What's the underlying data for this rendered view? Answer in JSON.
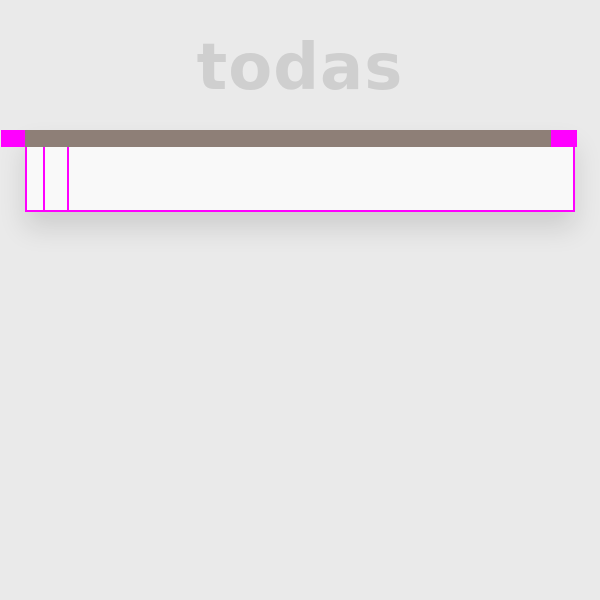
{
  "header": {
    "title": "todas"
  },
  "colors": {
    "background": "#eaeaea",
    "panel_bar": "#8e7f77",
    "panel_body": "#f9f9f9",
    "accent": "#ff00ff",
    "title_text": "#cfcfcf"
  }
}
